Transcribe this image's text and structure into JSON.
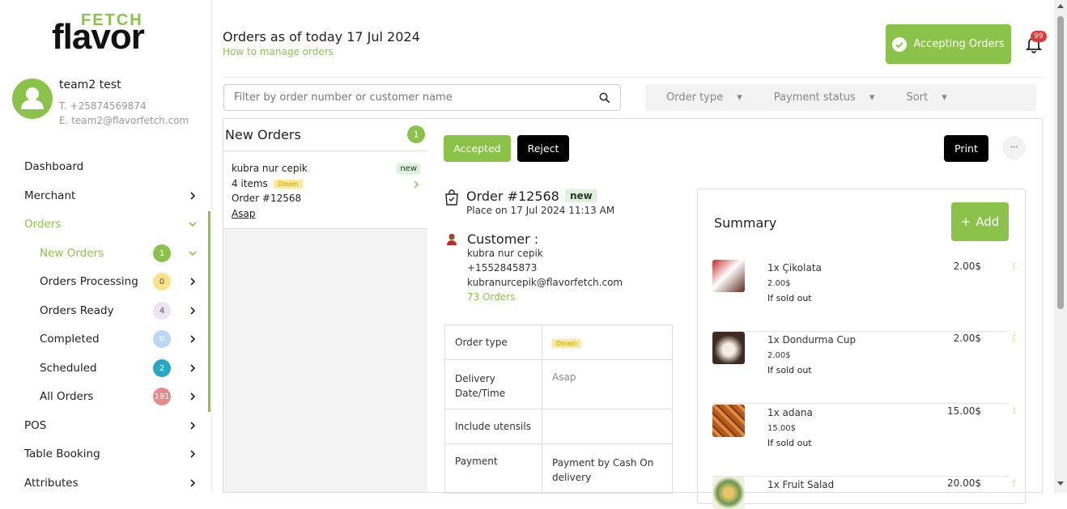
{
  "brand": {
    "line1": "FETCH",
    "line2": "flavor"
  },
  "user": {
    "name": "team2 test",
    "phone": "T. +25874569874",
    "email": "E. team2@flavorfetch.com"
  },
  "nav": {
    "dashboard": "Dashboard",
    "merchant": "Merchant",
    "orders": "Orders",
    "new_orders": {
      "label": "New Orders",
      "count": "1"
    },
    "processing": {
      "label": "Orders Processing",
      "count": "0"
    },
    "ready": {
      "label": "Orders Ready",
      "count": "4"
    },
    "completed": {
      "label": "Completed",
      "count": "0"
    },
    "scheduled": {
      "label": "Scheduled",
      "count": "2"
    },
    "all": {
      "label": "All Orders",
      "count": "191"
    },
    "pos": "POS",
    "table_booking": "Table Booking",
    "attributes": "Attributes"
  },
  "header": {
    "title": "Orders as of today 17 Jul 2024",
    "howto": "How to manage orders",
    "accepting": "Accepting Orders",
    "notifications": "99"
  },
  "filters": {
    "search_placeholder": "Filter by order number or customer name",
    "order_type": "Order type",
    "payment_status": "Payment status",
    "sort": "Sort"
  },
  "new_orders_panel": {
    "title": "New Orders",
    "count": "1",
    "card": {
      "name": "kubra nur cepik",
      "badge": "new",
      "items": "4 items",
      "type": "Dinein",
      "number": "Order #12568",
      "timing": "Asap"
    }
  },
  "order": {
    "accepted": "Accepted",
    "reject": "Reject",
    "print": "Print",
    "more": "···",
    "title": "Order #12568",
    "badge": "new",
    "placed": "Place on 17 Jul 2024 11:13 AM",
    "customer_heading": "Customer :",
    "customer_name": "kubra nur cepik",
    "customer_phone": "+1552845873",
    "customer_email": "kubranurcepik@flavorfetch.com",
    "customer_orders": "73 Orders",
    "info": [
      {
        "label": "Order type",
        "value": "Dinein"
      },
      {
        "label": "Delivery Date/Time",
        "value": "Asap"
      },
      {
        "label": "Include utensils",
        "value": ""
      },
      {
        "label": "Payment",
        "value": "Payment by Cash On delivery"
      }
    ]
  },
  "summary": {
    "title": "Summary",
    "add": "Add",
    "items": [
      {
        "name": "1x Çikolata",
        "unit": "2.00$",
        "note": "If sold out",
        "price": "2.00$"
      },
      {
        "name": "1x Dondurma Cup",
        "unit": "2.00$",
        "note": "If sold out",
        "price": "2.00$"
      },
      {
        "name": "1x adana",
        "unit": "15.00$",
        "note": "If sold out",
        "price": "15.00$"
      },
      {
        "name": "1x Fruit Salad",
        "unit": "",
        "note": "",
        "price": "20.00$"
      }
    ]
  },
  "colors": {
    "accent": "#8bc34a",
    "badge_red": "#e53935"
  }
}
